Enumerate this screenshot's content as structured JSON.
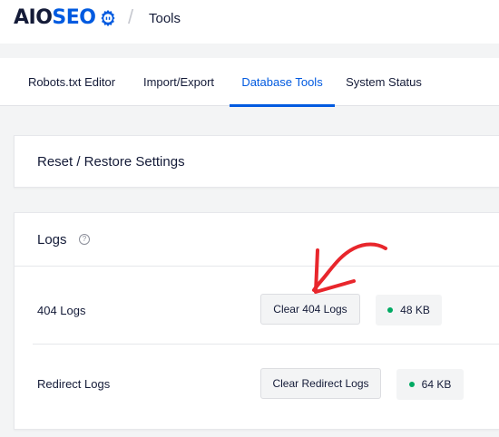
{
  "header": {
    "logo_aio": "AIO",
    "logo_seo": "SEO",
    "separator": "/",
    "title": "Tools"
  },
  "tabs": [
    {
      "label": "Robots.txt Editor",
      "active": false
    },
    {
      "label": "Import/Export",
      "active": false
    },
    {
      "label": "Database Tools",
      "active": true
    },
    {
      "label": "System Status",
      "active": false
    }
  ],
  "reset_card": {
    "title": "Reset / Restore Settings"
  },
  "logs_card": {
    "title": "Logs",
    "help_icon": "?",
    "rows": [
      {
        "label": "404 Logs",
        "button": "Clear 404 Logs",
        "size": "48 KB"
      },
      {
        "label": "Redirect Logs",
        "button": "Clear Redirect Logs",
        "size": "64 KB"
      }
    ]
  },
  "colors": {
    "accent": "#005ae0",
    "status_green": "#00aa63",
    "annotation_red": "#e8262c"
  },
  "icons": [
    "gear-icon",
    "help-icon",
    "annotation-arrow"
  ]
}
